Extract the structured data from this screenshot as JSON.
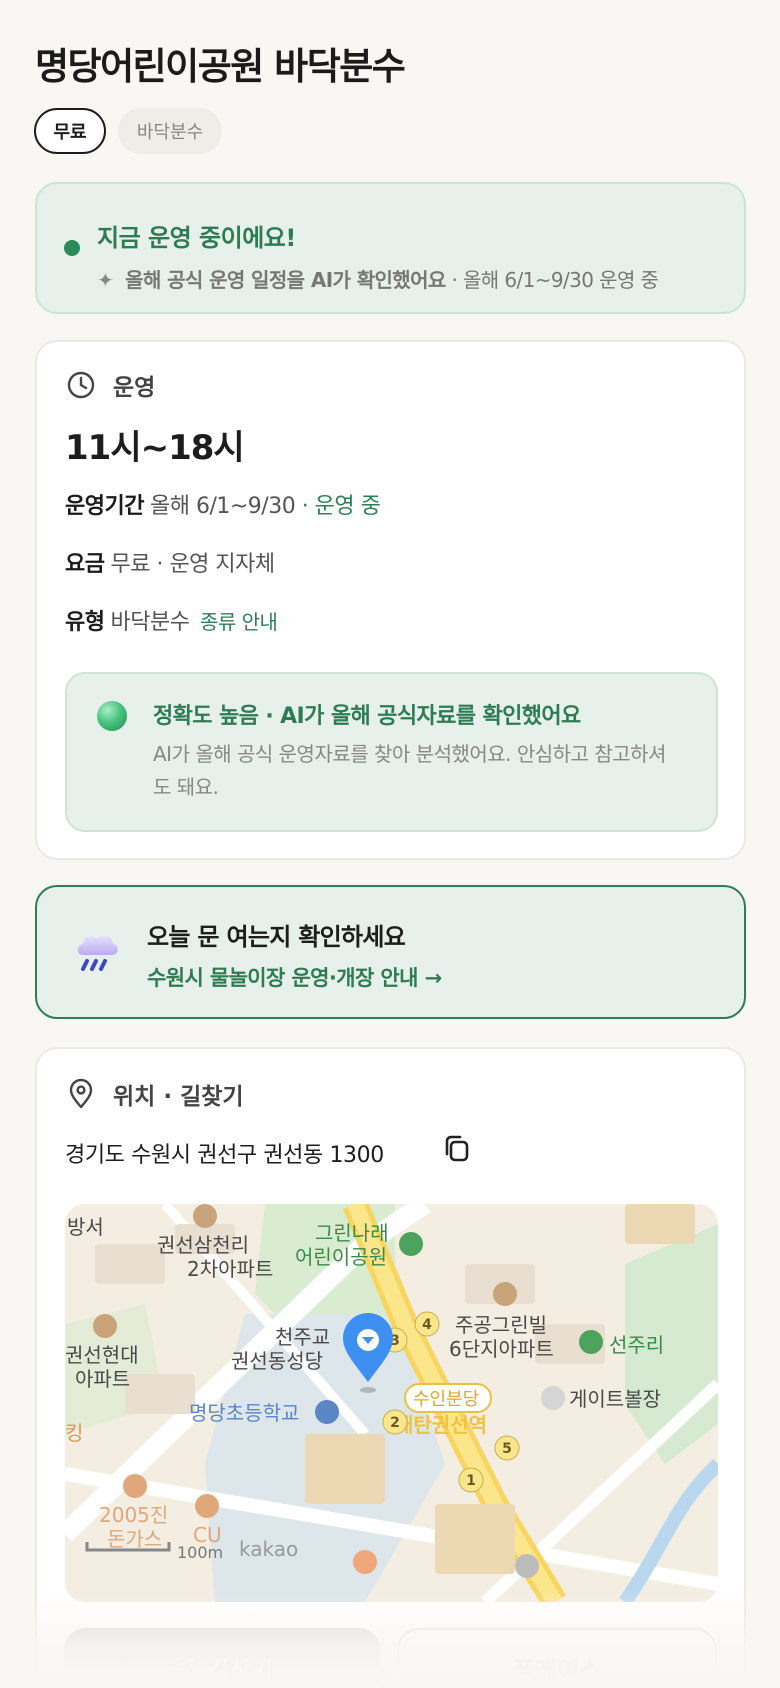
{
  "header": {
    "title": "명당어린이공원 바닥분수",
    "chips": [
      "무료",
      "바닥분수"
    ]
  },
  "status": {
    "title": "지금 운영 중이에요!",
    "sub_bold": "올해 공식 운영 일정을 AI가 확인했어요",
    "sub_rest": "· 올해 6/1~9/30 운영 중"
  },
  "info": {
    "section_label": "운영",
    "hours": "11시~18시",
    "period_label": "운영기간",
    "period_value": "올해 6/1~9/30",
    "period_status": "· 운영 중",
    "fee_label": "요금",
    "fee_value": "무료 · 운영 지자체",
    "type_label": "유형",
    "type_value": "바닥분수",
    "type_link": "종류 안내",
    "accuracy_title": "정확도 높음 · AI가 올해 공식자료를 확인했어요",
    "accuracy_body": "AI가 올해 공식 운영자료를 찾아 분석했어요. 안심하고 참고하셔도 돼요."
  },
  "open_check": {
    "title": "오늘 문 여는지 확인하세요",
    "link": "수원시 물놀이장 운영·개장 안내 →"
  },
  "location": {
    "section_label": "위치 · 길찾기",
    "address": "경기도 수원시 권선구 권선동 1300",
    "map": {
      "labels": {
        "topleft": "방서",
        "apt1": "권선삼천리",
        "apt1b": "2차아파트",
        "park": "그린나래",
        "parkb": "어린이공원",
        "apt2": "주공그린빌",
        "apt2b": "6단지아파트",
        "church": "천주교",
        "churchb": "권선동성당",
        "apt3": "권선현대",
        "apt3b": "아파트",
        "school": "명당초등학교",
        "sunjuri": "선주리",
        "gate": "게이트볼장",
        "station": "수인분당",
        "stationb": "매탄권선역",
        "king": "킹",
        "rest": "2005진",
        "restb": "돈가스",
        "cu": "CU",
        "scale": "100m",
        "kakao": "kakao"
      }
    }
  },
  "actions": {
    "navigate": "길찾기",
    "place": "플레이스"
  }
}
